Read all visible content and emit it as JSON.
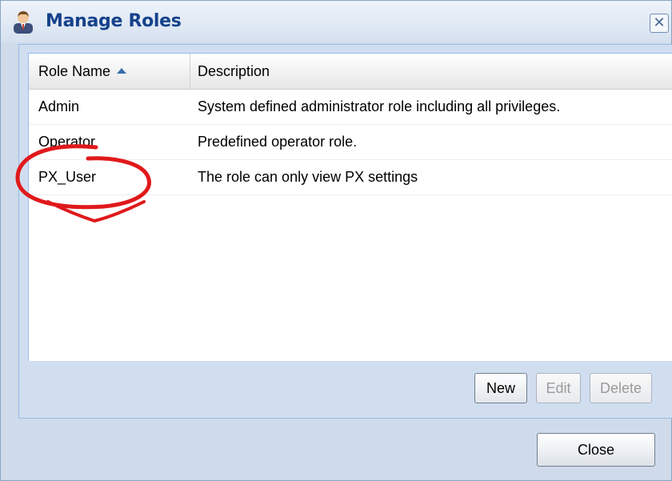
{
  "dialog": {
    "title": "Manage Roles",
    "close_icon": "close-x-icon",
    "title_icon": "user-icon"
  },
  "grid": {
    "columns": [
      {
        "label": "Role Name",
        "sorted": "ascending"
      },
      {
        "label": "Description"
      }
    ],
    "rows": [
      {
        "name": "Admin",
        "description": "System defined administrator role including all privileges."
      },
      {
        "name": "Operator",
        "description": "Predefined operator role."
      },
      {
        "name": "PX_User",
        "description": "The role can only view PX settings"
      }
    ]
  },
  "buttons": {
    "new": "New",
    "edit": "Edit",
    "delete": "Delete",
    "close": "Close"
  },
  "annotation": {
    "color": "#e0191b",
    "target": "PX_User"
  }
}
